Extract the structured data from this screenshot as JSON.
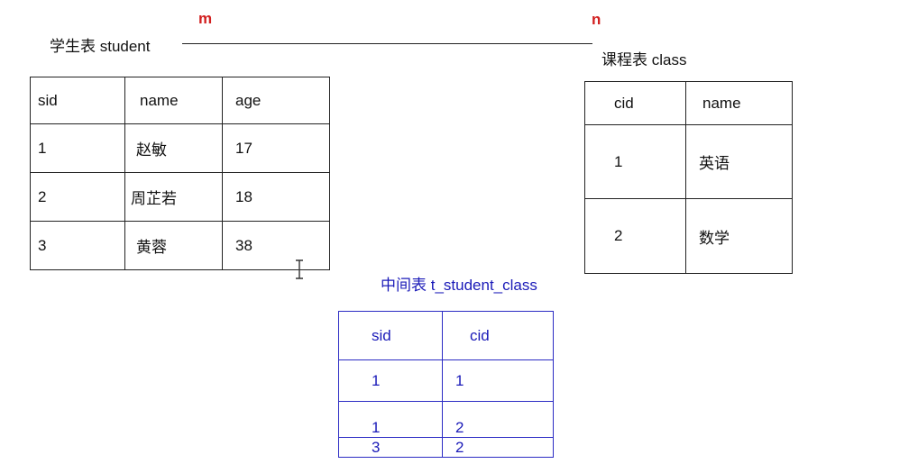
{
  "student": {
    "title": "学生表  student",
    "columns": [
      "sid",
      "name",
      "age"
    ],
    "rows": [
      [
        "1",
        "赵敏",
        "17"
      ],
      [
        "2",
        "周芷若",
        "18"
      ],
      [
        "3",
        "黄蓉",
        "38"
      ]
    ]
  },
  "relationship": {
    "left_multiplicity": "m",
    "right_multiplicity": "n"
  },
  "class": {
    "title": "课程表   class",
    "columns": [
      "cid",
      "name"
    ],
    "rows": [
      [
        "1",
        "英语"
      ],
      [
        "2",
        "数学"
      ]
    ]
  },
  "junction": {
    "title": "中间表  t_student_class",
    "columns": [
      "sid",
      "cid"
    ],
    "rows": [
      [
        "1",
        "1"
      ],
      [
        "1",
        "2"
      ],
      [
        "3",
        "2"
      ]
    ]
  },
  "colors": {
    "multiplicity": "#d21f1f",
    "junction_border": "#2b2bc4",
    "junction_text": "#1a1ab8",
    "line": "#222222"
  }
}
